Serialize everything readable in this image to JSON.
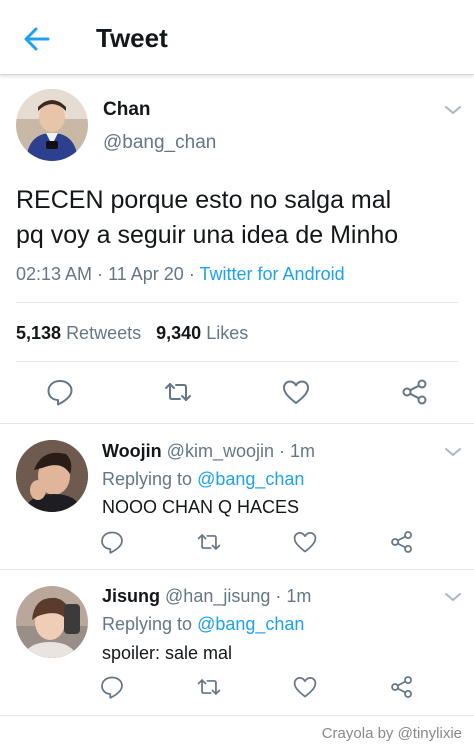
{
  "header": {
    "title": "Tweet"
  },
  "main_tweet": {
    "name": "Chan",
    "handle": "@bang_chan",
    "text_line1": "RECEN porque esto no salga mal",
    "text_line2": "pq voy a seguir una idea de Minho",
    "time": "02:13 AM",
    "date_sep": "·",
    "date": "11 Apr 20",
    "source_sep": "·",
    "source": "Twitter for Android",
    "retweet_count": "5,138",
    "retweet_label": "Retweets",
    "like_count": "9,340",
    "like_label": "Likes"
  },
  "replies": [
    {
      "name": "Woojin",
      "handle": "@kim_woojin",
      "sep": "·",
      "time": "1m",
      "replying_label": "Replying to",
      "replying_to": "@bang_chan",
      "text": "NOOO CHAN Q HACES"
    },
    {
      "name": "Jisung",
      "handle": "@han_jisung",
      "sep": "·",
      "time": "1m",
      "replying_label": "Replying to",
      "replying_to": "@bang_chan",
      "text": "spoiler: sale mal"
    }
  ],
  "footer": {
    "credit": "Crayola by @tinylixie"
  },
  "colors": {
    "accent": "#1da1f2",
    "muted": "#657786",
    "text": "#14171a",
    "divider": "#e1e8ed"
  }
}
